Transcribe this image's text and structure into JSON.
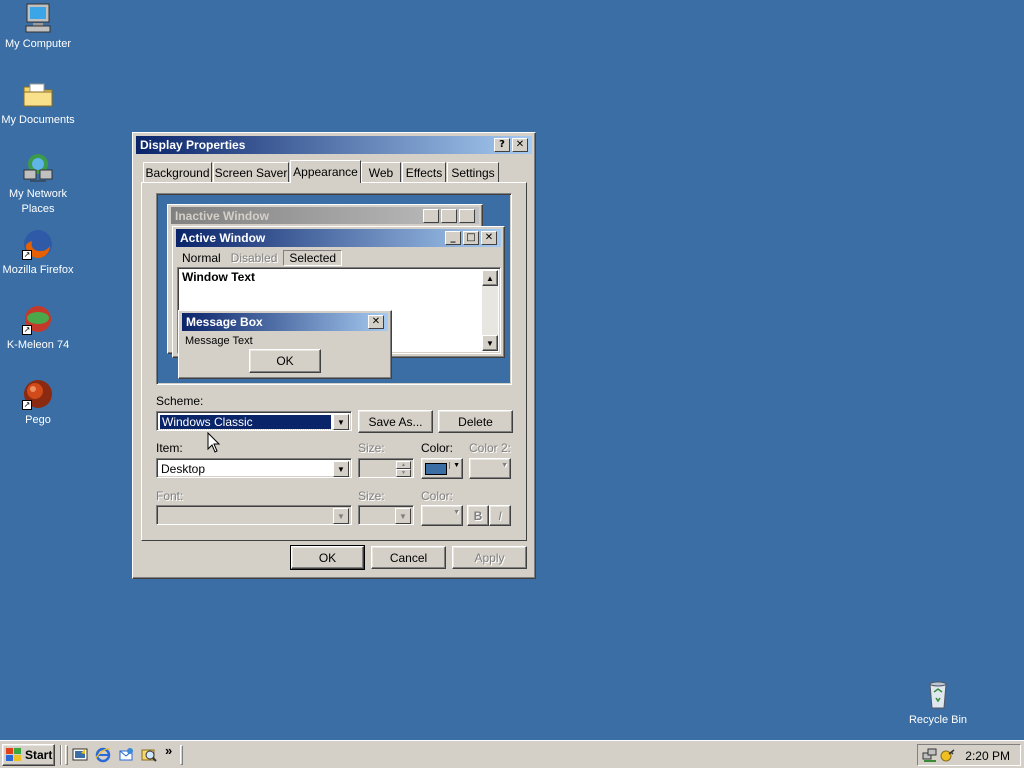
{
  "desktop": {
    "icons": [
      {
        "label": "My Computer",
        "icon": "computer-icon"
      },
      {
        "label": "My Documents",
        "icon": "folder-icon"
      },
      {
        "label": "My Network Places",
        "icon": "network-icon"
      },
      {
        "label": "Mozilla Firefox",
        "icon": "firefox-icon"
      },
      {
        "label": "K-Meleon 74",
        "icon": "kmeleon-icon"
      },
      {
        "label": "Pego",
        "icon": "pego-icon"
      },
      {
        "label": "Recycle Bin",
        "icon": "recycle-bin-icon"
      }
    ],
    "background_color": "#3a6ea5"
  },
  "window": {
    "title": "Display Properties",
    "help_glyph": "?",
    "close_glyph": "✕",
    "tabs": [
      "Background",
      "Screen Saver",
      "Appearance",
      "Web",
      "Effects",
      "Settings"
    ],
    "active_tab": "Appearance",
    "preview": {
      "inactive_title": "Inactive Window",
      "active_title": "Active Window",
      "menu": [
        "Normal",
        "Disabled",
        "Selected"
      ],
      "window_text": "Window Text",
      "msgbox_title": "Message Box",
      "msgbox_text": "Message Text",
      "msgbox_ok": "OK"
    },
    "scheme": {
      "label": "Scheme:",
      "value": "Windows Classic",
      "save_as": "Save As...",
      "delete": "Delete"
    },
    "item": {
      "label": "Item:",
      "value": "Desktop",
      "size_label": "Size:",
      "color_label": "Color:",
      "color2_label": "Color 2:",
      "color_value": "#3a6ea5"
    },
    "font": {
      "label": "Font:",
      "size_label": "Size:",
      "color_label": "Color:",
      "bold": "B",
      "italic": "I"
    },
    "buttons": {
      "ok": "OK",
      "cancel": "Cancel",
      "apply": "Apply"
    }
  },
  "taskbar": {
    "start_label": "Start",
    "quicklaunch": [
      "desktop-icon",
      "ie-icon",
      "outlook-icon",
      "search-icon"
    ],
    "chevron": "»",
    "clock": "2:20 PM"
  }
}
